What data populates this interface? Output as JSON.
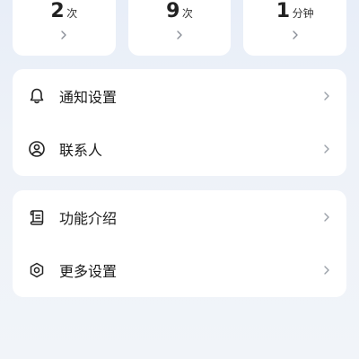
{
  "stats": [
    {
      "number": "2",
      "unit": "次"
    },
    {
      "number": "9",
      "unit": "次"
    },
    {
      "number": "1",
      "unit": "分钟"
    }
  ],
  "menu_group_1": [
    {
      "label": "通知设置",
      "icon": "bell-icon"
    },
    {
      "label": "联系人",
      "icon": "user-icon"
    }
  ],
  "menu_group_2": [
    {
      "label": "功能介绍",
      "icon": "scroll-icon"
    },
    {
      "label": "更多设置",
      "icon": "settings-hex-icon"
    }
  ]
}
